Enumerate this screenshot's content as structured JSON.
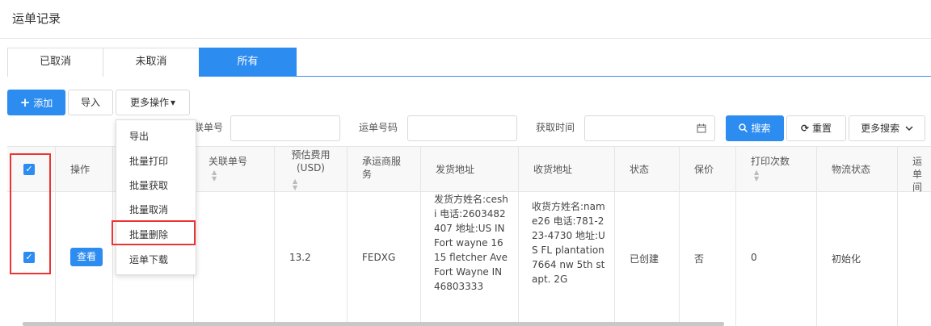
{
  "page": {
    "title": "运单记录"
  },
  "tabs": [
    {
      "label": "已取消",
      "active": false
    },
    {
      "label": "未取消",
      "active": false
    },
    {
      "label": "所有",
      "active": true
    }
  ],
  "toolbar": {
    "add_icon": "plus-icon",
    "add_label": "添加",
    "import_label": "导入",
    "more_label": "更多操作",
    "more_caret": "▾"
  },
  "dropdown": {
    "items": [
      "导出",
      "批量打印",
      "批量获取",
      "批量取消",
      "批量删除",
      "运单下载"
    ]
  },
  "filters": {
    "related_label": "联单号",
    "related_value": "",
    "waybill_label": "运单号码",
    "waybill_value": "",
    "time_label": "获取时间",
    "time_value": "",
    "calendar_icon": "calendar-icon",
    "search_label": "搜索",
    "search_icon": "search-icon",
    "reset_label": "重置",
    "reset_icon": "refresh-icon",
    "more_search_label": "更多搜索",
    "more_search_icon": "chevron-down-icon"
  },
  "table": {
    "headers": {
      "action": "操作",
      "related": "关联单号",
      "fee": "预估费用\n(USD)",
      "carrier": "承运商服\n务",
      "ship_from": "发货地址",
      "ship_to": "收货地址",
      "status": "状态",
      "insured": "保价",
      "print_count": "打印次数",
      "logistics": "物流状态",
      "waybill_time": "运单\n间"
    },
    "rows": [
      {
        "checked": true,
        "view_label": "查看",
        "related": "",
        "fee": "13.2",
        "carrier": "FEDXG",
        "ship_from": "发货方姓名:ceshi 电话:2603482407 地址:US IN Fort wayne 1615 fletcher Ave Fort Wayne IN 46803333",
        "ship_to": "收货方姓名:name26 电话:781-223-4730 地址:US FL plantation 7664 nw 5th st apt. 2G",
        "status": "已创建",
        "insured": "否",
        "print_count": "0",
        "logistics": "初始化"
      }
    ]
  },
  "colors": {
    "primary": "#2d8cf0",
    "highlight": "#e33333"
  }
}
